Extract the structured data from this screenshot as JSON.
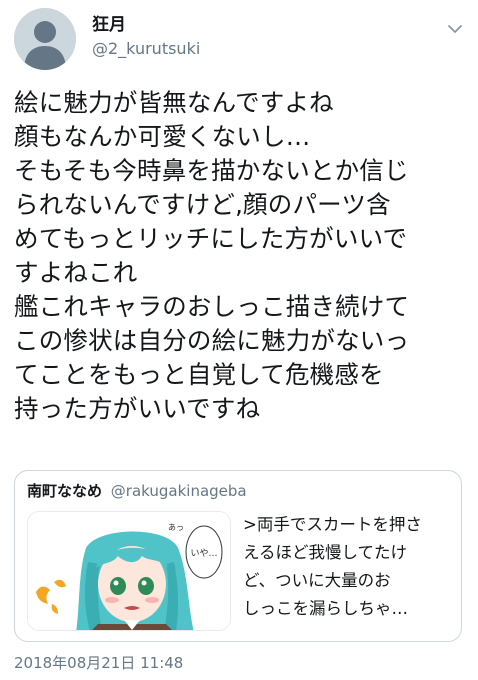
{
  "tweet": {
    "author_name": "狂月",
    "author_handle": "@2_kurutsuki",
    "text_lines": [
      "絵に魅力が皆無なんですよね",
      "顔もなんか可愛くないし…",
      "そもそも今時鼻を描かないとか信じ",
      "られないんですけど,顔のパーツ含",
      "めてもっとリッチにした方がいいで",
      "すよねこれ",
      "艦これキャラのおしっこ描き続けて",
      "この惨状は自分の絵に魅力がないっ",
      "てことをもっと自覚して危機感を",
      "持った方がいいですね"
    ],
    "timestamp": "2018年08月21日 11:48",
    "avatar_icon": "default-avatar-icon",
    "menu_icon": "chevron-down-icon"
  },
  "quoted_tweet": {
    "author_name": "南町ななめ",
    "author_handle": "@rakugakinageba",
    "text_lines": [
      ">両手でスカートを押さ",
      "えるほど我慢してたけ",
      "ど、ついに大量のお",
      "しっこを漏らしちゃ…"
    ],
    "thumbnail_icon": "anime-illustration-thumbnail",
    "thumbnail_bubble_text": "いや…",
    "thumbnail_small_text": "あっ"
  },
  "colors": {
    "text_primary": "#14171a",
    "text_secondary": "#657786",
    "border": "#ccd6dd",
    "avatar_bg": "#ccd6dd",
    "avatar_fg": "#657786"
  }
}
